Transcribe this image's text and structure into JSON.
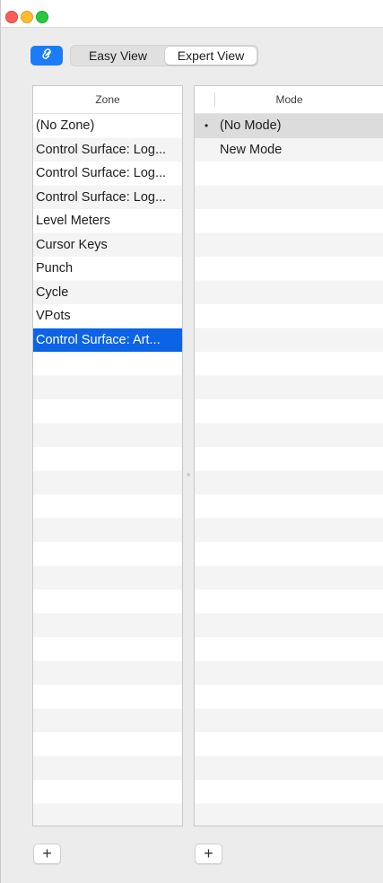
{
  "window": {
    "controls": [
      "close",
      "minimize",
      "zoom"
    ]
  },
  "toolbar": {
    "link_icon": "link-icon",
    "view_toggle": {
      "easy_label": "Easy View",
      "expert_label": "Expert View",
      "selected": "Expert View"
    }
  },
  "zone_table": {
    "header": "Zone",
    "items": [
      "(No Zone)",
      "Control Surface: Log...",
      "Control Surface: Log...",
      "Control Surface: Log...",
      "Level Meters",
      "Cursor Keys",
      "Punch",
      "Cycle",
      "VPots",
      "Control Surface: Art..."
    ],
    "selected_index": 9,
    "add_label": "+"
  },
  "mode_table": {
    "header": "Mode",
    "items": [
      "(No Mode)",
      "New Mode"
    ],
    "selected_index": 0,
    "bullet": "•",
    "add_label": "+"
  },
  "colors": {
    "accent": "#0b63e5",
    "link_button": "#1a7cf7",
    "close": "#ff5f57",
    "minimize": "#febc2e",
    "zoom": "#28c840"
  }
}
